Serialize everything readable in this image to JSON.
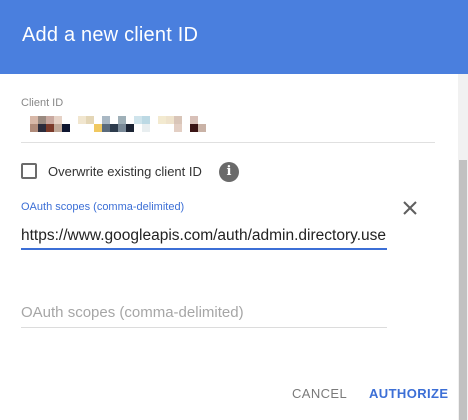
{
  "dialog": {
    "title": "Add a new client ID"
  },
  "client_id": {
    "label": "Client ID"
  },
  "overwrite": {
    "label": "Overwrite existing client ID",
    "checked": false,
    "info_icon": "info-icon"
  },
  "scopes_field_1": {
    "label": "OAuth scopes (comma-delimited)",
    "value": "https://www.googleapis.com/auth/admin.directory.user",
    "clear_icon": "close-icon"
  },
  "scopes_field_2": {
    "placeholder": "OAuth scopes (comma-delimited)"
  },
  "actions": {
    "cancel_label": "CANCEL",
    "authorize_label": "AUTHORIZE"
  },
  "colors": {
    "header": "#4a7fde",
    "accent": "#3c6fd6"
  }
}
